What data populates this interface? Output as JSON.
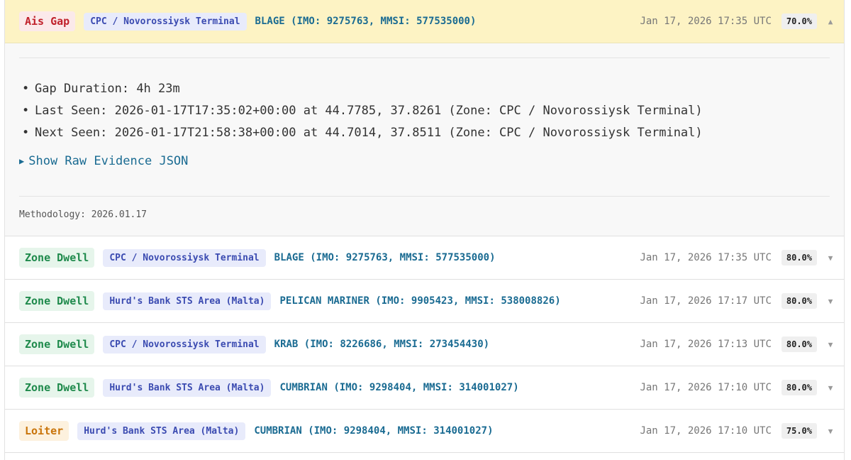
{
  "expanded": {
    "type_label": "Ais Gap",
    "zone": "CPC / Novorossiysk Terminal",
    "vessel": "BLAGE (IMO: 9275763, MMSI: 577535000)",
    "timestamp": "Jan 17, 2026 17:35 UTC",
    "confidence": "70.0%",
    "chevron": "▲",
    "details": [
      {
        "label": "Gap Duration:",
        "value": "4h 23m"
      },
      {
        "label": "Last Seen:",
        "value": "2026-01-17T17:35:02+00:00 at 44.7785, 37.8261 (Zone: CPC / Novorossiysk Terminal)"
      },
      {
        "label": "Next Seen:",
        "value": "2026-01-17T21:58:38+00:00 at 44.7014, 37.8511 (Zone: CPC / Novorossiysk Terminal)"
      }
    ],
    "raw_toggle_label": "Show Raw Evidence JSON",
    "methodology": "Methodology: 2026.01.17"
  },
  "rows": [
    {
      "type_label": "Zone Dwell",
      "zone": "CPC / Novorossiysk Terminal",
      "vessel": "BLAGE (IMO: 9275763, MMSI: 577535000)",
      "timestamp": "Jan 17, 2026 17:35 UTC",
      "confidence": "80.0%",
      "chevron": "▼"
    },
    {
      "type_label": "Zone Dwell",
      "zone": "Hurd's Bank STS Area (Malta)",
      "vessel": "PELICAN MARINER (IMO: 9905423, MMSI: 538008826)",
      "timestamp": "Jan 17, 2026 17:17 UTC",
      "confidence": "80.0%",
      "chevron": "▼"
    },
    {
      "type_label": "Zone Dwell",
      "zone": "CPC / Novorossiysk Terminal",
      "vessel": "KRAB (IMO: 8226686, MMSI: 273454430)",
      "timestamp": "Jan 17, 2026 17:13 UTC",
      "confidence": "80.0%",
      "chevron": "▼"
    },
    {
      "type_label": "Zone Dwell",
      "zone": "Hurd's Bank STS Area (Malta)",
      "vessel": "CUMBRIAN (IMO: 9298404, MMSI: 314001027)",
      "timestamp": "Jan 17, 2026 17:10 UTC",
      "confidence": "80.0%",
      "chevron": "▼"
    },
    {
      "type_label": "Loiter",
      "zone": "Hurd's Bank STS Area (Malta)",
      "vessel": "CUMBRIAN (IMO: 9298404, MMSI: 314001027)",
      "timestamp": "Jan 17, 2026 17:10 UTC",
      "confidence": "75.0%",
      "chevron": "▼"
    }
  ]
}
